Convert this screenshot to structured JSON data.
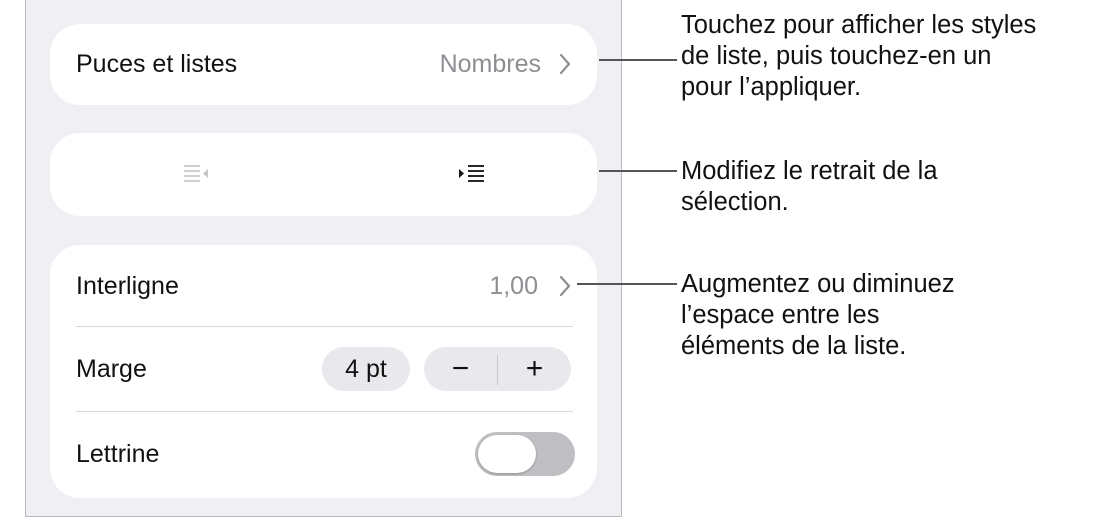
{
  "panel": {
    "bullets_row": {
      "label": "Puces et listes",
      "value": "Nombres"
    },
    "indent_controls": {
      "decrease_icon": "outdent-icon",
      "increase_icon": "indent-icon"
    },
    "spacing_row": {
      "label": "Interligne",
      "value": "1,00"
    },
    "margin_row": {
      "label": "Marge",
      "value": "4 pt",
      "minus": "−",
      "plus": "+"
    },
    "dropcap_row": {
      "label": "Lettrine",
      "toggle_on": false
    }
  },
  "callouts": [
    {
      "text": "Touchez pour afficher les styles\nde liste, puis touchez-en un\npour l’appliquer."
    },
    {
      "text": "Modifiez le retrait de la\nsélection."
    },
    {
      "text": "Augmentez ou diminuez\nl’espace entre les\néléments de la liste."
    }
  ],
  "colors": {
    "panel_bg": "#efeff4",
    "card_bg": "#ffffff",
    "secondary_text": "#8e8e93",
    "toggle_off": "#bfbfc3"
  }
}
